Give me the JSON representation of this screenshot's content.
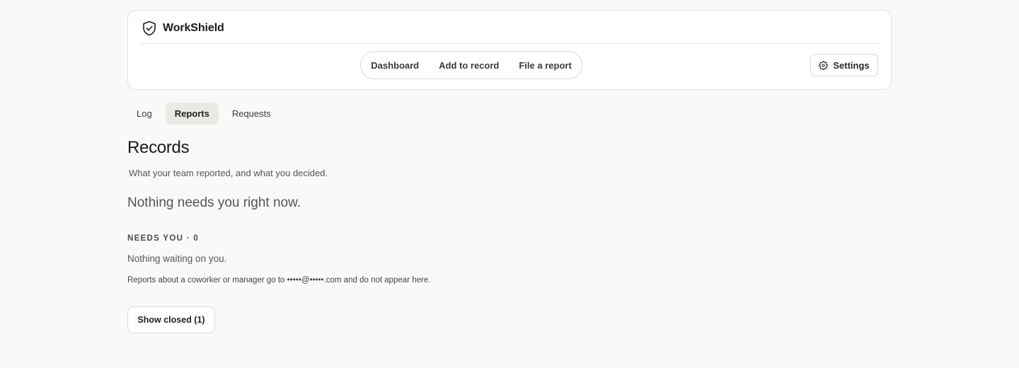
{
  "app": {
    "name": "WorkShield",
    "logo_icon": "shield-check-icon"
  },
  "nav": {
    "links": [
      "Dashboard",
      "Add to record",
      "File a report"
    ],
    "settings_label": "Settings",
    "settings_icon": "gear-icon"
  },
  "tabs": [
    {
      "label": "Log",
      "active": false
    },
    {
      "label": "Reports",
      "active": true
    },
    {
      "label": "Requests",
      "active": false
    }
  ],
  "page": {
    "title": "Records",
    "subtitle": "What your team reported, and what you decided.",
    "empty_lead": "Nothing needs you right now."
  },
  "needs_you": {
    "label": "NEEDS YOU · 0",
    "empty_text": "Nothing waiting on you."
  },
  "note": "Reports about a coworker or manager go to •••••@•••••.com and do not appear here.",
  "show_closed_label": "Show closed (1)",
  "colors": {
    "background": "#faf9f7",
    "card": "#ffffff",
    "border": "#e2e0dc",
    "active_tab": "#ebe9e6"
  }
}
